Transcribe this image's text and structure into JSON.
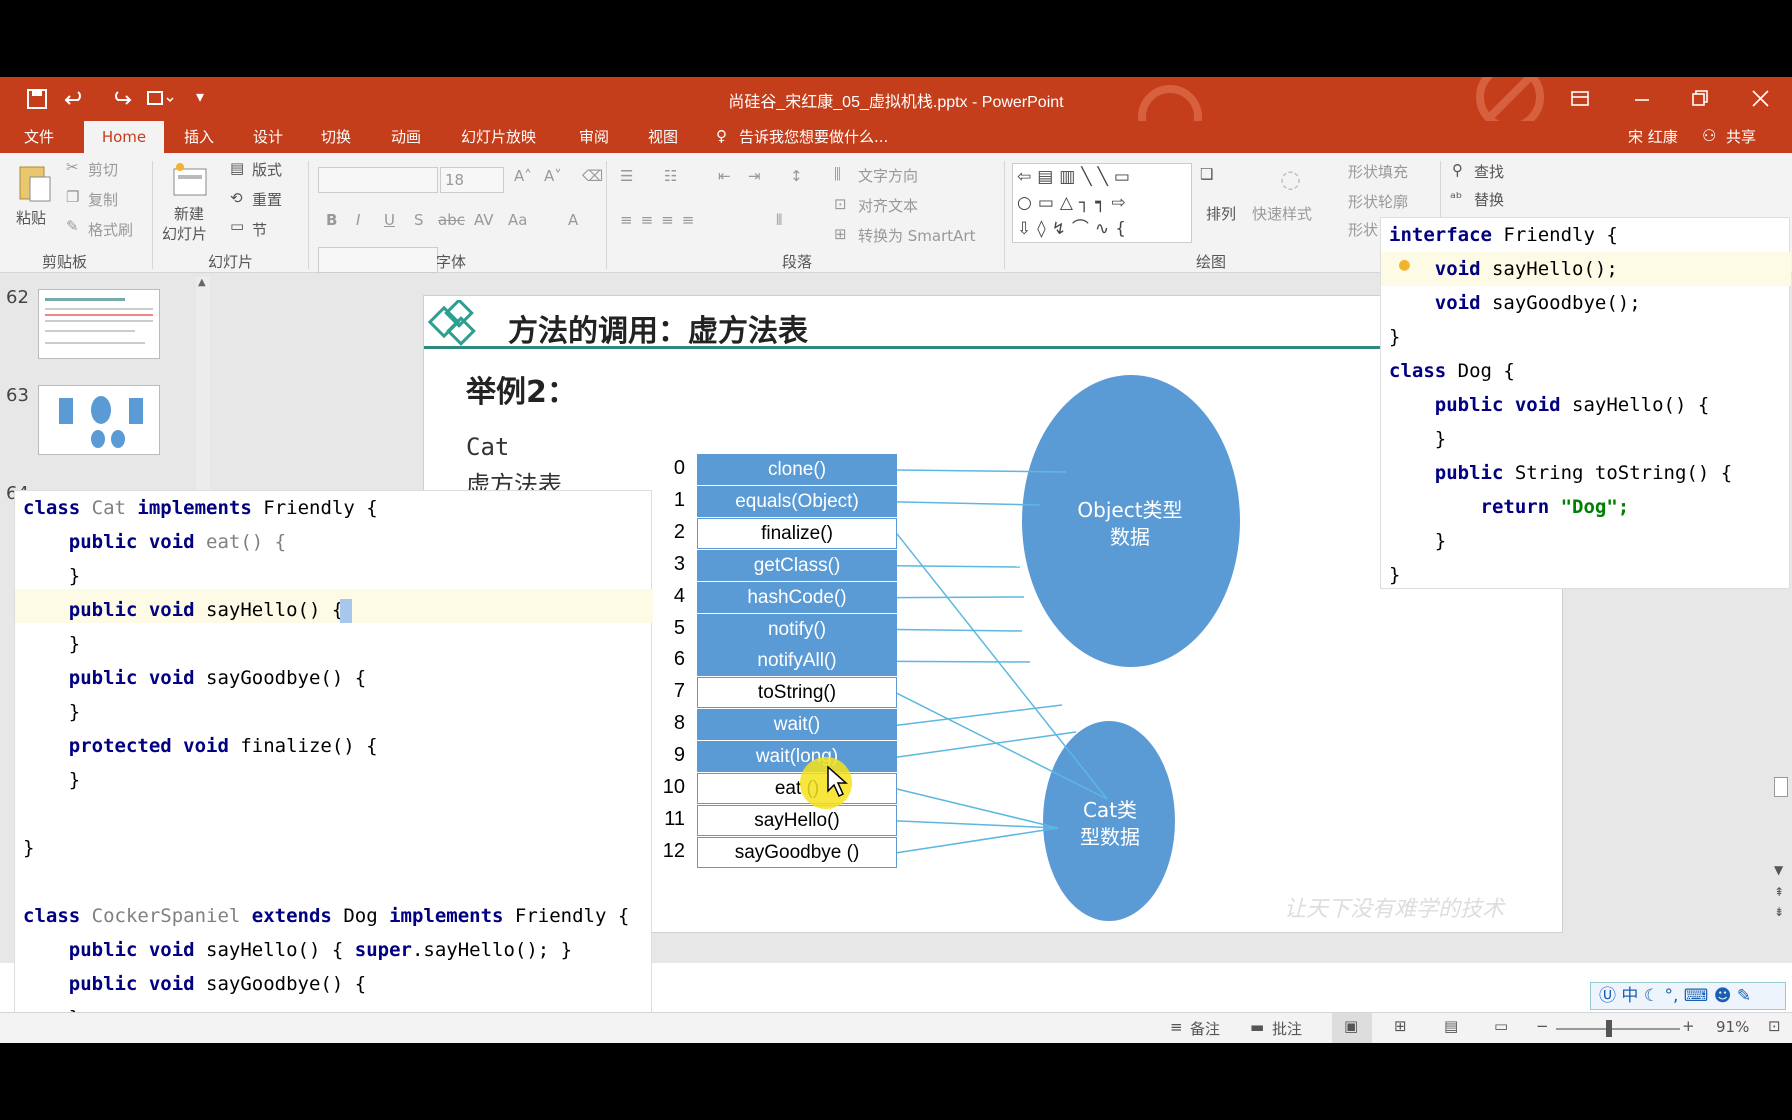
{
  "window": {
    "title": "尚硅谷_宋红康_05_虚拟机栈.pptx - PowerPoint"
  },
  "tabs": [
    "文件",
    "Home",
    "插入",
    "设计",
    "切换",
    "动画",
    "幻灯片放映",
    "审阅",
    "视图"
  ],
  "tell_me": "告诉我您想要做什么...",
  "user": {
    "name": "宋 红康",
    "share": "共享"
  },
  "ribbon": {
    "clipboard": {
      "paste": "粘贴",
      "cut": "剪切",
      "copy": "复制",
      "format_painter": "格式刷",
      "label": "剪贴板"
    },
    "slides": {
      "new_slide_1": "新建",
      "new_slide_2": "幻灯片",
      "layout": "版式",
      "reset": "重置",
      "section": "节",
      "label": "幻灯片"
    },
    "font": {
      "size": "18",
      "label": "字体"
    },
    "paragraph": {
      "text_direction": "文字方向",
      "align_text": "对齐文本",
      "smartart": "转换为 SmartArt",
      "label": "段落"
    },
    "drawing": {
      "arrange": "排列",
      "quick_styles": "快速样式",
      "shape_fill": "形状填充",
      "shape_outline": "形状轮廓",
      "shape_effects": "形状",
      "label": "绘图"
    },
    "editing": {
      "find": "查找",
      "replace": "替换"
    }
  },
  "thumbnails": [
    {
      "number": "62"
    },
    {
      "number": "63"
    },
    {
      "number": "64"
    }
  ],
  "slide": {
    "title": "方法的调用：虚方法表",
    "example": "举例2：",
    "cat_label_1": "Cat",
    "cat_label_2": "虚方法表",
    "object_ellipse_1": "Object类型",
    "object_ellipse_2": "数据",
    "cat_ellipse_1": "Cat类",
    "cat_ellipse_2": "型数据",
    "watermark": "让天下没有难学的技术",
    "method_table": [
      {
        "index": "0",
        "name": "clone()",
        "style": "blue"
      },
      {
        "index": "1",
        "name": "equals(Object)",
        "style": "blue"
      },
      {
        "index": "2",
        "name": "finalize()",
        "style": "white"
      },
      {
        "index": "3",
        "name": "getClass()",
        "style": "blue"
      },
      {
        "index": "4",
        "name": "hashCode()",
        "style": "blue"
      },
      {
        "index": "5",
        "name": "notify()",
        "style": "blue"
      },
      {
        "index": "6",
        "name": "notifyAll()",
        "style": "blue"
      },
      {
        "index": "7",
        "name": "toString()",
        "style": "white"
      },
      {
        "index": "8",
        "name": "wait()",
        "style": "blue"
      },
      {
        "index": "9",
        "name": "wait(long)",
        "style": "blue"
      },
      {
        "index": "10",
        "name": "eat ()",
        "style": "white"
      },
      {
        "index": "11",
        "name": "sayHello()",
        "style": "white"
      },
      {
        "index": "12",
        "name": "sayGoodbye ()",
        "style": "white"
      }
    ]
  },
  "code_left": {
    "lines": [
      {
        "kw1": "class ",
        "t1": "Cat ",
        "kw2": "implements ",
        "t2": "Friendly {"
      },
      {
        "kw1": "    public void ",
        "t1": "eat() {",
        "kw2": "",
        "t2": ""
      },
      {
        "kw1": "",
        "t1": "    }",
        "kw2": "",
        "t2": ""
      },
      {
        "kw1": "    public void ",
        "t1": "sayHello() {",
        "kw2": "",
        "t2": ""
      },
      {
        "kw1": "",
        "t1": "    }",
        "kw2": "",
        "t2": ""
      },
      {
        "kw1": "    public void ",
        "t1": "sayGoodbye() {",
        "kw2": "",
        "t2": ""
      },
      {
        "kw1": "",
        "t1": "    }",
        "kw2": "",
        "t2": ""
      },
      {
        "kw1": "    protected void ",
        "t1": "finalize() {",
        "kw2": "",
        "t2": ""
      },
      {
        "kw1": "",
        "t1": "    }",
        "kw2": "",
        "t2": ""
      },
      {
        "kw1": "",
        "t1": "",
        "kw2": "",
        "t2": ""
      },
      {
        "kw1": "",
        "t1": "}",
        "kw2": "",
        "t2": ""
      },
      {
        "kw1": "",
        "t1": "",
        "kw2": "",
        "t2": ""
      },
      {
        "kw1": "class ",
        "t1": "CockerSpaniel ",
        "kw2": "extends ",
        "t2": "Dog "
      },
      {
        "kw1": "    public void ",
        "t1": "sayHello() { ",
        "kw2": "super",
        "t2": ".sayHello(); }"
      },
      {
        "kw1": "    public void ",
        "t1": "sayGoodbye() {",
        "kw2": "",
        "t2": ""
      },
      {
        "kw1": "",
        "t1": "    }",
        "kw2": "",
        "t2": ""
      }
    ],
    "line12_tail_kw": "implements ",
    "line12_tail": "Friendly {"
  },
  "code_right": {
    "lines": [
      {
        "kw1": "interface ",
        "t1": "Friendly {",
        "kw2": "",
        "t2": ""
      },
      {
        "kw1": "    void ",
        "t1": "sayHello();",
        "kw2": "",
        "t2": ""
      },
      {
        "kw1": "    void ",
        "t1": "sayGoodbye();",
        "kw2": "",
        "t2": ""
      },
      {
        "kw1": "",
        "t1": "}",
        "kw2": "",
        "t2": ""
      },
      {
        "kw1": "class ",
        "t1": "Dog {",
        "kw2": "",
        "t2": ""
      },
      {
        "kw1": "    public void ",
        "t1": "sayHello() {",
        "kw2": "",
        "t2": ""
      },
      {
        "kw1": "",
        "t1": "    }",
        "kw2": "",
        "t2": ""
      },
      {
        "kw1": "    public ",
        "t1": "String toString() {",
        "kw2": "",
        "t2": ""
      },
      {
        "kw1": "        return ",
        "t1": "",
        "kw2": "",
        "t2": "\"Dog\";"
      },
      {
        "kw1": "",
        "t1": "    }",
        "kw2": "",
        "t2": ""
      },
      {
        "kw1": "",
        "t1": "}",
        "kw2": "",
        "t2": ""
      }
    ]
  },
  "status": {
    "notes": "备注",
    "comments": "批注",
    "zoom": "91%"
  },
  "ime": {
    "lang": "中"
  }
}
